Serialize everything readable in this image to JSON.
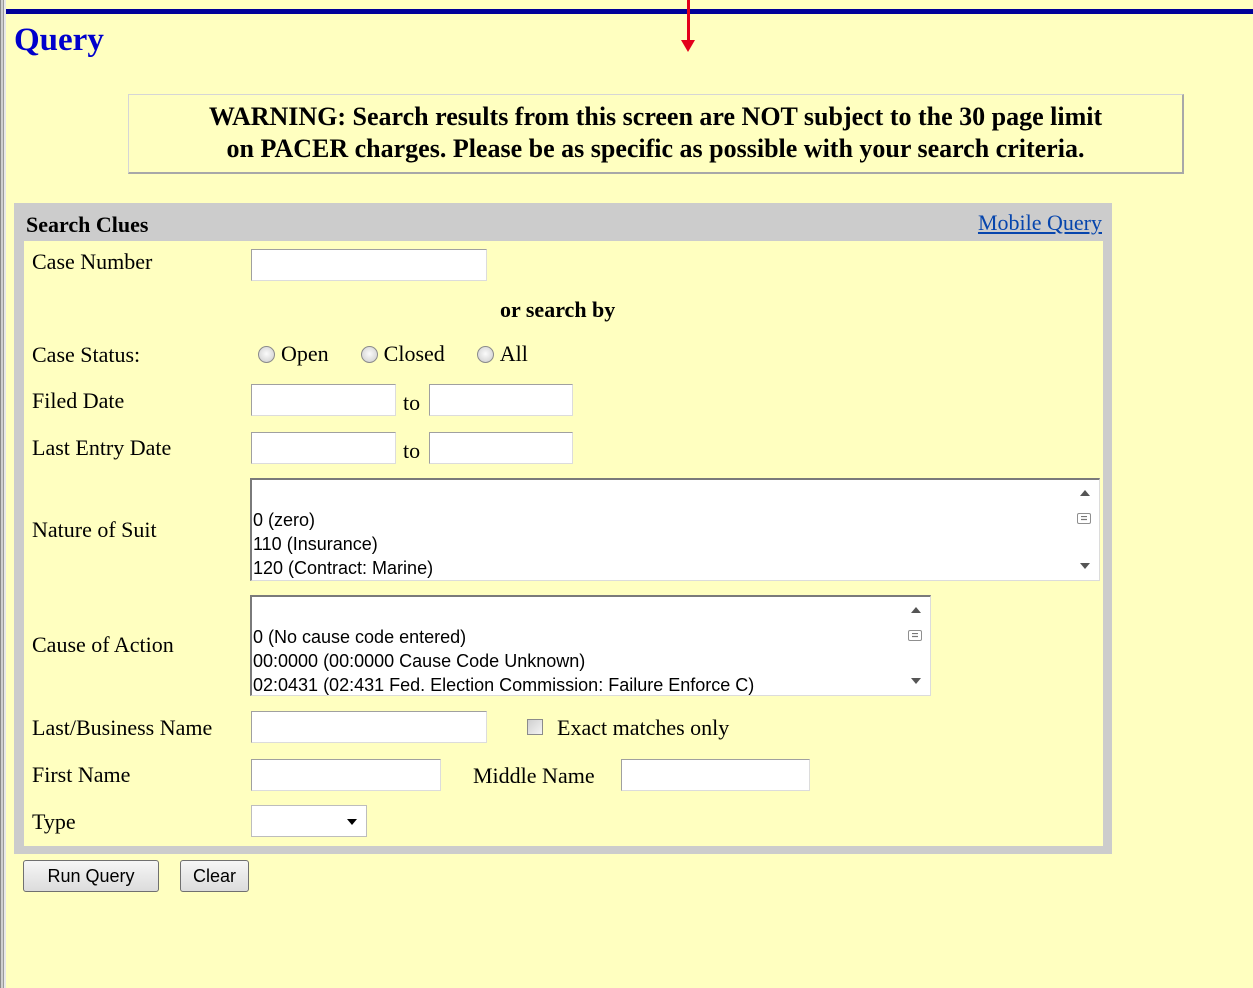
{
  "page": {
    "title": "Query"
  },
  "warning": {
    "line1": "WARNING: Search results from this screen are NOT subject to the 30 page limit",
    "line2": "on PACER charges. Please be as specific as possible with your search criteria."
  },
  "search_clues": {
    "title": "Search Clues",
    "mobile_link": "Mobile Query"
  },
  "fields": {
    "case_number": {
      "label": "Case Number",
      "value": ""
    },
    "or_search_by": "or search by",
    "case_status": {
      "label": "Case Status:",
      "options": [
        "Open",
        "Closed",
        "All"
      ],
      "selected": null
    },
    "filed_date": {
      "label": "Filed Date",
      "to": "to",
      "from_value": "",
      "to_value": ""
    },
    "last_entry_date": {
      "label": "Last Entry Date",
      "to": "to",
      "from_value": "",
      "to_value": ""
    },
    "nature_of_suit": {
      "label": "Nature of Suit",
      "items": [
        "0 (zero)",
        "110 (Insurance)",
        "120 (Contract: Marine)"
      ]
    },
    "cause_of_action": {
      "label": "Cause of Action",
      "items": [
        "0 (No cause code entered)",
        "00:0000 (00:0000 Cause Code Unknown)",
        "02:0431 (02:431 Fed. Election Commission: Failure Enforce C)"
      ]
    },
    "last_business_name": {
      "label": "Last/Business Name",
      "value": ""
    },
    "exact_matches": {
      "label": "Exact matches only",
      "checked": false
    },
    "first_name": {
      "label": "First Name",
      "value": ""
    },
    "middle_name": {
      "label": "Middle Name",
      "value": ""
    },
    "type": {
      "label": "Type",
      "value": ""
    }
  },
  "buttons": {
    "run_query": "Run Query",
    "clear": "Clear"
  },
  "colors": {
    "background": "#ffffc0",
    "title": "#0000cc",
    "top_bar": "#000099",
    "annotation_arrow": "#e3001b",
    "panel": "#cccccc",
    "link": "#0645ad"
  }
}
